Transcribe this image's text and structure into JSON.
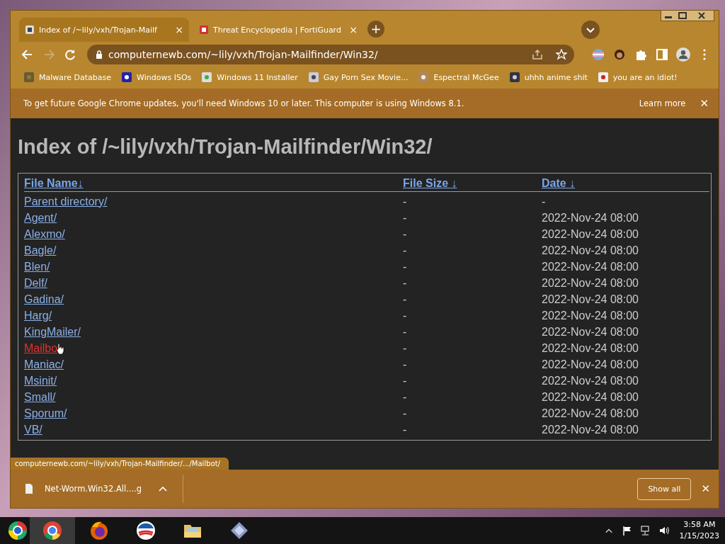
{
  "tabs": [
    {
      "title": "Index of /~lily/vxh/Trojan-Mailf",
      "selected": true,
      "close": "×"
    },
    {
      "title": "Threat Encyclopedia | FortiGuard",
      "selected": false,
      "close": "×"
    }
  ],
  "new_tab": "+",
  "address_bar": {
    "url": "computernewb.com/~lily/vxh/Trojan-Mailfinder/Win32/"
  },
  "bookmarks": [
    {
      "label": "Malware Database"
    },
    {
      "label": "Windows ISOs"
    },
    {
      "label": "Windows 11 Installer"
    },
    {
      "label": "Gay Porn Sex Movie..."
    },
    {
      "label": "Espectral McGee"
    },
    {
      "label": "uhhh anime shit"
    },
    {
      "label": "you are an idiot!"
    }
  ],
  "infobar": {
    "message": "To get future Google Chrome updates, you'll need Windows 10 or later. This computer is using Windows 8.1.",
    "link": "Learn more",
    "close": "✕"
  },
  "page": {
    "heading": "Index of /~lily/vxh/Trojan-Mailfinder/Win32/",
    "columns": [
      {
        "label": "File Name",
        "sort": "↓"
      },
      {
        "label": "File Size",
        "sort": "↓"
      },
      {
        "label": "Date",
        "sort": "↓"
      }
    ],
    "rows": [
      {
        "name": "Parent directory/",
        "size": "-",
        "date": "-",
        "hovered": false
      },
      {
        "name": "Agent/",
        "size": "-",
        "date": "2022-Nov-24 08:00",
        "hovered": false
      },
      {
        "name": "Alexmo/",
        "size": "-",
        "date": "2022-Nov-24 08:00",
        "hovered": false
      },
      {
        "name": "Bagle/",
        "size": "-",
        "date": "2022-Nov-24 08:00",
        "hovered": false
      },
      {
        "name": "Blen/",
        "size": "-",
        "date": "2022-Nov-24 08:00",
        "hovered": false
      },
      {
        "name": "Delf/",
        "size": "-",
        "date": "2022-Nov-24 08:00",
        "hovered": false
      },
      {
        "name": "Gadina/",
        "size": "-",
        "date": "2022-Nov-24 08:00",
        "hovered": false
      },
      {
        "name": "Harg/",
        "size": "-",
        "date": "2022-Nov-24 08:00",
        "hovered": false
      },
      {
        "name": "KingMailer/",
        "size": "-",
        "date": "2022-Nov-24 08:00",
        "hovered": false
      },
      {
        "name": "Mailbo",
        "size": "-",
        "date": "2022-Nov-24 08:00",
        "hovered": true
      },
      {
        "name": "Maniac/",
        "size": "-",
        "date": "2022-Nov-24 08:00",
        "hovered": false
      },
      {
        "name": "Msinit/",
        "size": "-",
        "date": "2022-Nov-24 08:00",
        "hovered": false
      },
      {
        "name": "Small/",
        "size": "-",
        "date": "2022-Nov-24 08:00",
        "hovered": false
      },
      {
        "name": "Sporum/",
        "size": "-",
        "date": "2022-Nov-24 08:00",
        "hovered": false
      },
      {
        "name": "VB/",
        "size": "-",
        "date": "2022-Nov-24 08:00",
        "hovered": false
      }
    ]
  },
  "status_bubble": "computernewb.com/~lily/vxh/Trojan-Mailfinder/.../Mailbot/",
  "download_bar": {
    "file": "Net-Worm.Win32.All....g",
    "button": "Show all",
    "close": "✕"
  },
  "taskbar": {
    "time": "3:58 AM",
    "date": "1/15/2023"
  }
}
